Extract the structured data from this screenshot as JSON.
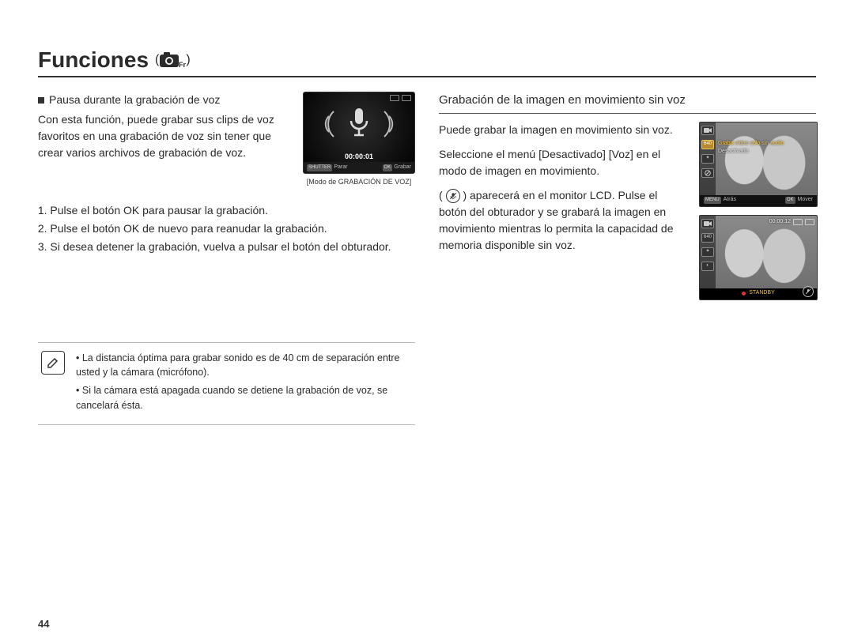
{
  "header": {
    "title": "Funciones",
    "open_paren": " ( ",
    "close_paren": " )"
  },
  "left": {
    "bullet_heading": "Pausa durante la grabación de voz",
    "intro": "Con esta función, puede grabar sus clips de voz favoritos en una grabación de voz sin tener que crear varios archivos de grabación de voz.",
    "thumb_timer": "00:00:01",
    "thumb_footer_left_label": "SHUTTER",
    "thumb_footer_left_text": "Parar",
    "thumb_footer_right_label": "OK",
    "thumb_footer_right_text": "Grabar",
    "thumb_caption": "[Modo de GRABACIÓN DE VOZ]",
    "steps": [
      "Pulse el botón OK para pausar la grabación.",
      "Pulse el botón OK de nuevo para reanudar la grabación.",
      "Si desea detener la grabación, vuelva a pulsar el botón del obturador."
    ]
  },
  "notes": [
    "La distancia óptima para grabar sonido es de 40 cm de separación entre usted y la cámara (micrófono).",
    "Si la cámara está apagada cuando se detiene la grabación de voz, se cancelará ésta."
  ],
  "right": {
    "heading": "Grabación de la imagen en movimiento sin voz",
    "p1": "Puede grabar la imagen en movimiento sin voz.",
    "p2_a": "Seleccione el menú [Desactivado] [Voz] en el modo de imagen en movimiento.",
    "p2_b": "aparecerá en el monitor LCD. Pulse el botón del obturador y se grabará la imagen en movimiento mientras lo permita la capacidad de memoria disponible sin voz.",
    "open_p": "( ",
    "close_p": " ) ",
    "thumb1": {
      "left_badge": "640",
      "line1": "Graba vídeo sólo sin audio",
      "line2": "Desactivado",
      "foot_left": "Atrás",
      "foot_left_label": "MENU",
      "foot_right": "Mover",
      "foot_right_label": "OK"
    },
    "thumb2": {
      "timecode": "00:00:12",
      "left_badge": "640",
      "standby": "STANDBY"
    }
  },
  "page_number": "44"
}
